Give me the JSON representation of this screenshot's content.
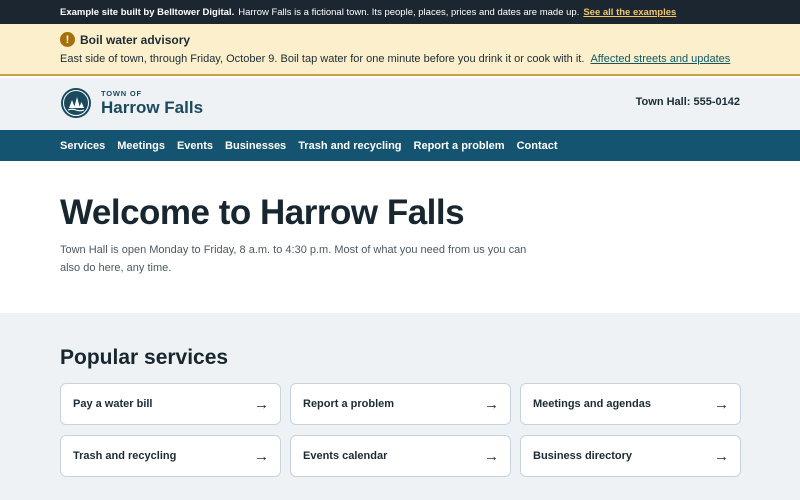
{
  "demo_bar": {
    "brand": "Example site built by Belltower Digital.",
    "description": "Harrow Falls is a fictional town. Its people, places, prices and dates are made up.",
    "link_label": "See all the examples"
  },
  "advisory": {
    "icon": "exclamation-icon",
    "icon_glyph": "!",
    "title": "Boil water advisory",
    "body": "East side of town, through Friday, October 9. Boil tap water for one minute before you drink it or cook with it.",
    "link_label": "Affected streets and updates"
  },
  "header": {
    "logo_small": "TOWN OF",
    "logo_name": "Harrow Falls",
    "phone": "Town Hall: 555-0142"
  },
  "nav": {
    "items": [
      {
        "label": "Services"
      },
      {
        "label": "Meetings"
      },
      {
        "label": "Events"
      },
      {
        "label": "Businesses"
      },
      {
        "label": "Trash and recycling"
      },
      {
        "label": "Report a problem"
      },
      {
        "label": "Contact"
      }
    ]
  },
  "hero": {
    "title": "Welcome to Harrow Falls",
    "intro": "Town Hall is open Monday to Friday, 8 a.m. to 4:30 p.m. Most of what you need from us you can also do here, any time."
  },
  "services": {
    "heading": "Popular services",
    "cards": [
      {
        "label": "Pay a water bill",
        "arrow": "→"
      },
      {
        "label": "Report a problem",
        "arrow": "→"
      },
      {
        "label": "Meetings and agendas",
        "arrow": "→"
      },
      {
        "label": "Trash and recycling",
        "arrow": "→"
      },
      {
        "label": "Events calendar",
        "arrow": "→"
      },
      {
        "label": "Business directory",
        "arrow": "→"
      }
    ]
  },
  "colors": {
    "demo_bar_bg": "#1c2631",
    "demo_link": "#f1c76a",
    "advisory_bg": "#fcf0cc",
    "advisory_icon": "#a5700c",
    "nav_bg": "#145471",
    "brand": "#1b4a5e",
    "section_bg": "#eef2f5"
  }
}
